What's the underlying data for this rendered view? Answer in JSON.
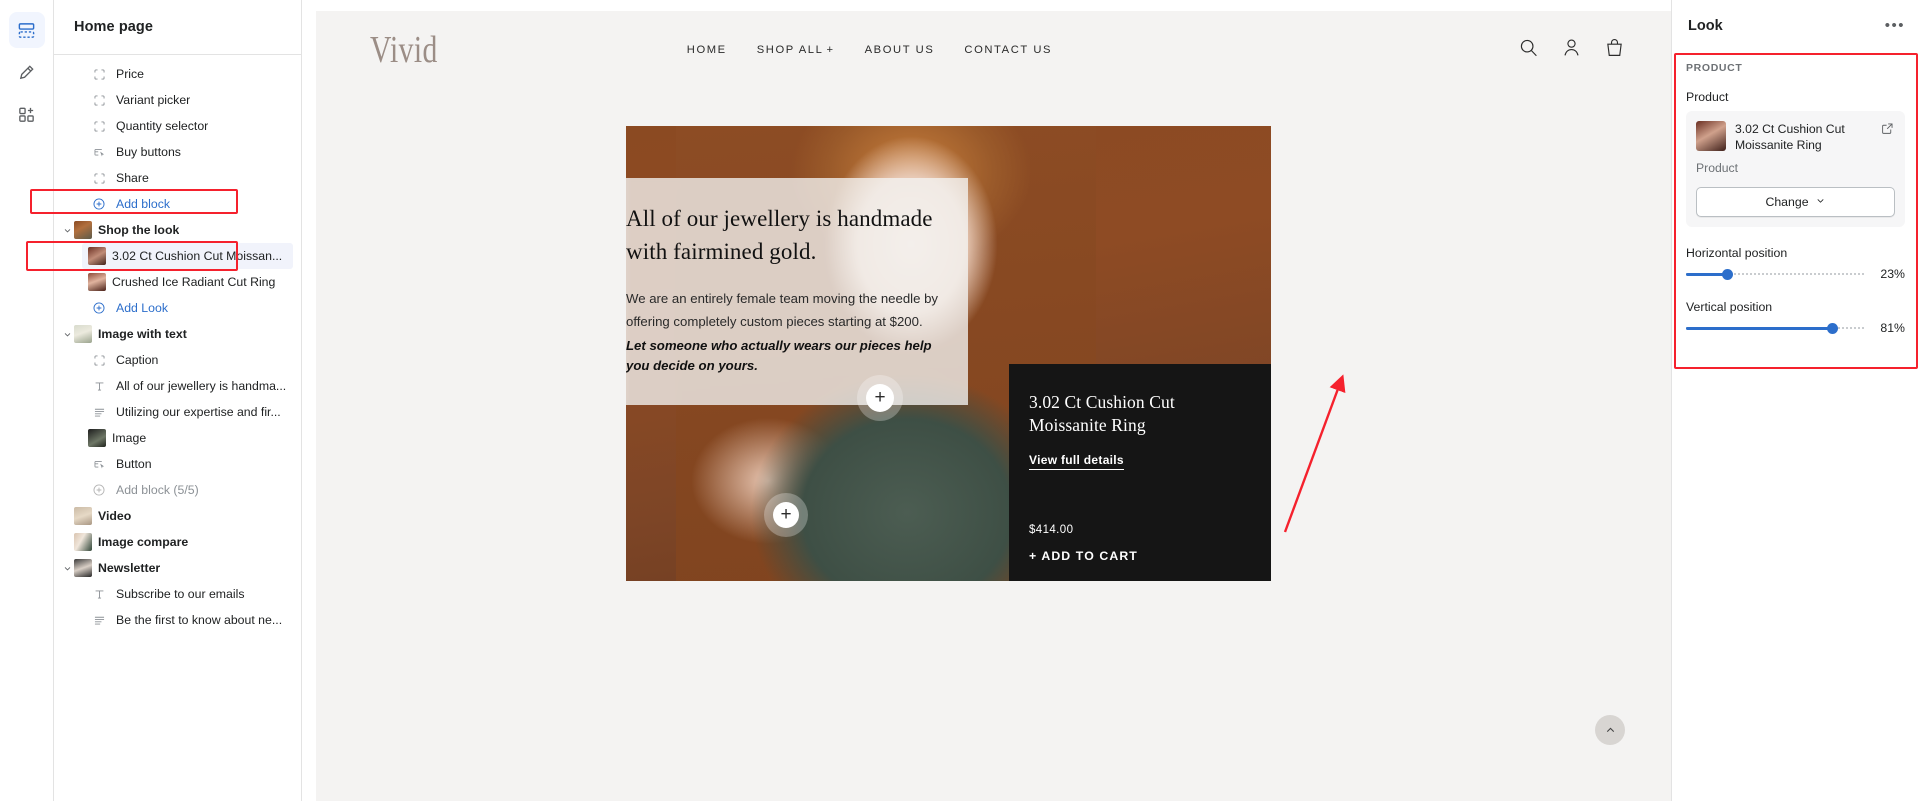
{
  "rail": {
    "items": [
      {
        "name": "sections-icon",
        "label": "Sections",
        "active": true
      },
      {
        "name": "theme-settings-icon",
        "label": "Theme settings",
        "active": false
      },
      {
        "name": "apps-icon",
        "label": "Apps",
        "active": false
      }
    ]
  },
  "sidebar": {
    "title": "Home page",
    "rows": [
      {
        "kind": "block",
        "icon": "placeholder-icon",
        "label": "Price"
      },
      {
        "kind": "block",
        "icon": "placeholder-icon",
        "label": "Variant picker"
      },
      {
        "kind": "block",
        "icon": "placeholder-icon",
        "label": "Quantity selector"
      },
      {
        "kind": "block",
        "icon": "button-icon",
        "label": "Buy buttons"
      },
      {
        "kind": "block",
        "icon": "placeholder-icon",
        "label": "Share"
      },
      {
        "kind": "addblock",
        "icon": "plus-circle-icon",
        "label": "Add block"
      },
      {
        "kind": "section",
        "icon": "thumb",
        "thumb": "tb-shop",
        "label": "Shop the look",
        "expanded": true
      },
      {
        "kind": "selected",
        "icon": "thumb",
        "thumb": "tb-look1",
        "label": "3.02 Ct Cushion Cut Moissan..."
      },
      {
        "kind": "child",
        "icon": "thumb",
        "thumb": "tb-look2",
        "label": "Crushed Ice Radiant Cut Ring"
      },
      {
        "kind": "addlook",
        "icon": "plus-circle-icon",
        "label": "Add Look"
      },
      {
        "kind": "section",
        "icon": "thumb",
        "thumb": "tb-iwt",
        "label": "Image with text",
        "expanded": true
      },
      {
        "kind": "block",
        "icon": "placeholder-icon",
        "label": "Caption"
      },
      {
        "kind": "block",
        "icon": "text-icon",
        "label": "All of our jewellery is handma..."
      },
      {
        "kind": "block",
        "icon": "paragraph-icon",
        "label": "Utilizing our expertise and fir..."
      },
      {
        "kind": "block",
        "icon": "thumb",
        "thumb": "tb-img",
        "label": "Image"
      },
      {
        "kind": "block",
        "icon": "button-icon",
        "label": "Button"
      },
      {
        "kind": "addblock-disabled",
        "icon": "plus-circle-icon",
        "label": "Add block (5/5)"
      },
      {
        "kind": "section-plain",
        "icon": "thumb",
        "thumb": "tb-video",
        "label": "Video"
      },
      {
        "kind": "section-plain",
        "icon": "thumb",
        "thumb": "tb-cmp",
        "label": "Image compare"
      },
      {
        "kind": "section",
        "icon": "thumb",
        "thumb": "tb-news",
        "label": "Newsletter",
        "expanded": true
      },
      {
        "kind": "block",
        "icon": "text-icon",
        "label": "Subscribe to our emails"
      },
      {
        "kind": "block",
        "icon": "paragraph-icon",
        "label": "Be the first to know about ne..."
      }
    ]
  },
  "preview": {
    "logo": "Vivid",
    "nav": [
      {
        "label": "HOME",
        "has_plus": false
      },
      {
        "label": "SHOP ALL",
        "has_plus": true
      },
      {
        "label": "ABOUT US",
        "has_plus": false
      },
      {
        "label": "CONTACT US",
        "has_plus": false
      }
    ],
    "header_icons": [
      {
        "name": "search-icon"
      },
      {
        "name": "account-icon"
      },
      {
        "name": "cart-icon"
      }
    ],
    "hero": {
      "heading": "All of our jewellery is handmade with fairmined gold.",
      "paragraph": "We are an entirely female team moving the needle by offering completely custom pieces starting at $200.",
      "emphasis": "Let someone who actually wears our pieces help you decide on yours."
    },
    "hotspots": [
      {
        "label": "+"
      },
      {
        "label": "+"
      }
    ],
    "product_card": {
      "name": "3.02 Ct Cushion Cut Moissanite Ring",
      "link": "View full details",
      "price": "$414.00",
      "cart": "+ ADD TO CART"
    },
    "scroll_top_icon": "chevron-up-icon"
  },
  "inspector": {
    "title": "Look",
    "more_label": "•••",
    "group_label": "PRODUCT",
    "product_field_label": "Product",
    "product": {
      "name": "3.02 Ct Cushion Cut Moissanite Ring",
      "subtitle": "Product",
      "external_icon": "external-link-icon"
    },
    "change_button": "Change",
    "sliders": [
      {
        "label": "Horizontal position",
        "value": 23,
        "value_text": "23%"
      },
      {
        "label": "Vertical position",
        "value": 81,
        "value_text": "81%"
      }
    ]
  },
  "colors": {
    "accent": "#2c6ecb",
    "annotation": "#f5212d",
    "card_bg": "#151515",
    "hero_bg": "#8b4a22"
  }
}
